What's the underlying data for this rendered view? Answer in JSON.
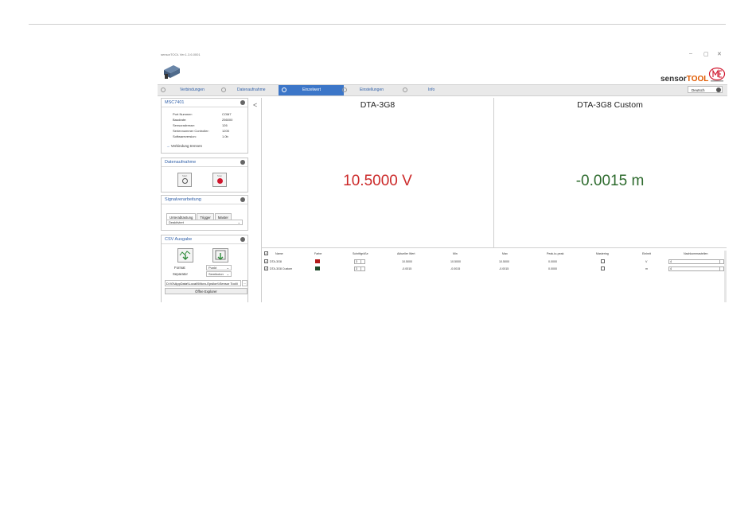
{
  "window": {
    "title": "sensorTOOL Ver.1.3.6.0001",
    "minimize": "–",
    "maximize": "▢",
    "close": "✕"
  },
  "brand": {
    "part1": "sensor",
    "part2": "TOOL"
  },
  "nav": {
    "items": [
      {
        "label": "Verbindungen",
        "active": false
      },
      {
        "label": "Datenaufnahme",
        "active": false
      },
      {
        "label": "Einzelwert",
        "active": true
      },
      {
        "label": "Einstellungen",
        "active": false
      },
      {
        "label": "Info",
        "active": false
      }
    ],
    "language": "Deutsch"
  },
  "device_panel": {
    "title": "MSC7401",
    "rows": [
      {
        "label": "Port Nummer:",
        "value": "COM7"
      },
      {
        "label": "Baudrate:",
        "value": "256000"
      },
      {
        "label": "Sensoradresse:",
        "value": "126"
      },
      {
        "label": "Seriennummer Controller:",
        "value": "1205"
      },
      {
        "label": "Softwareversion:",
        "value": "1.0b"
      }
    ],
    "disconnect": "Verbindung trennen"
  },
  "recording_panel": {
    "title": "Datenaufnahme",
    "start_label": "Start",
    "stop_label": "Stop"
  },
  "signal_panel": {
    "title": "Signalverarbeitung",
    "tabs": [
      "Unterabtastung",
      "Trigger",
      "Master"
    ],
    "select_value": "Deaktiviert"
  },
  "csv_panel": {
    "title": "CSV Ausgabe",
    "format_label": "Format",
    "format_value": "Punkt",
    "separator_label": "Separator",
    "separator_value": "Semikolon",
    "path": "D:\\\\0\\\\AppData\\\\Local\\\\Micro-Epsilon\\\\Sensor Tool\\\\",
    "path_button": "...",
    "open_explorer": "Öffne Explorer"
  },
  "displays": [
    {
      "name": "DTA-3G8",
      "value": "10.5000 V",
      "color": "#cc2a2a"
    },
    {
      "name": "DTA-3G8 Custom",
      "value": "-0.0015 m",
      "color": "#2e6b2e"
    }
  ],
  "table": {
    "headers": [
      "Name",
      "Farbe",
      "Schriftgröße",
      "Aktueller Wert",
      "Min",
      "Max",
      "Peak-to-peak",
      "Mastering",
      "Einheit",
      "Nachkommastellen"
    ],
    "rows": [
      {
        "name": "DTA-3G8",
        "color": "#b31b1b",
        "font_size": "3",
        "current": "10.5000",
        "min": "10.5000",
        "max": "10.5000",
        "p2p": "0.0000",
        "unit": "V",
        "decimals": "4"
      },
      {
        "name": "DTA-3G8 Custom",
        "color": "#1e4a2a",
        "font_size": "3",
        "current": "-0.0015",
        "min": "-0.0015",
        "max": "-0.0015",
        "p2p": "0.0000",
        "unit": "m",
        "decimals": "4"
      }
    ]
  },
  "colors": {
    "accent": "#3c76c8",
    "link": "#2f5fa8",
    "brand_orange": "#e05a00"
  }
}
